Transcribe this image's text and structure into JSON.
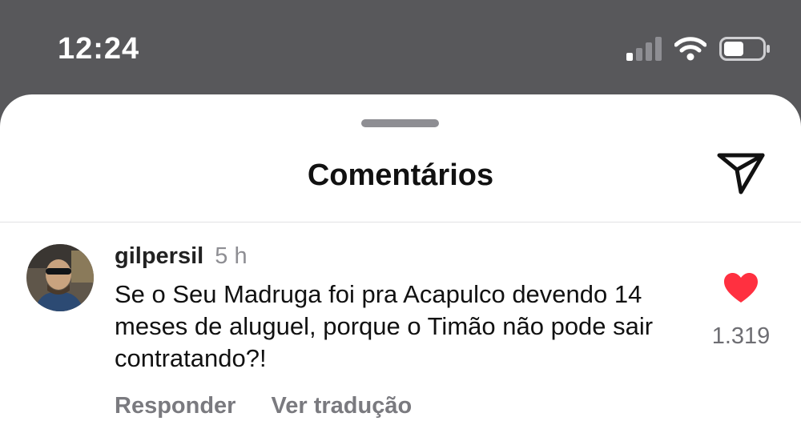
{
  "status_bar": {
    "time": "12:24",
    "icons": [
      "cellular-signal-icon",
      "wifi-icon",
      "battery-icon"
    ],
    "battery_level": 0.45
  },
  "sheet": {
    "title": "Comentários",
    "share_icon": "paper-plane-icon"
  },
  "comment": {
    "username": "gilpersil",
    "time_ago": "5 h",
    "text": "Se o Seu Madruga foi pra Acapulco devendo 14 meses de aluguel, porque o Timão não pode sair contratando?!",
    "like_icon": "heart-filled-icon",
    "likes": "1.319",
    "reply_label": "Responder",
    "translate_label": "Ver tradução"
  },
  "colors": {
    "status_bar_bg": "#58585b",
    "like_red": "#ff3040",
    "secondary_text": "#8e8e93"
  }
}
